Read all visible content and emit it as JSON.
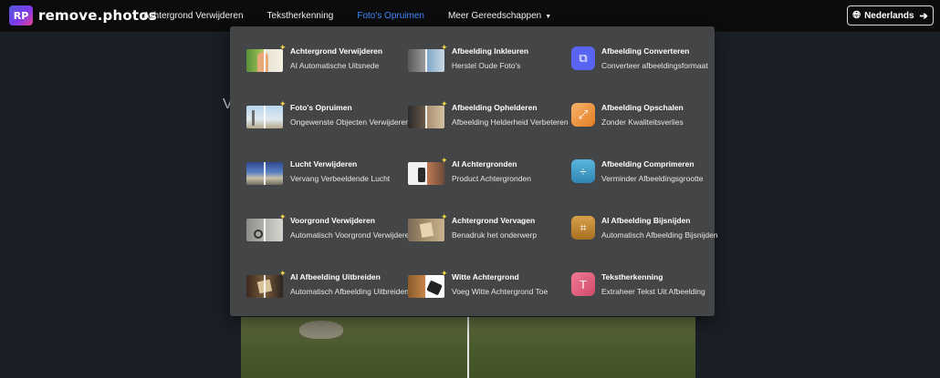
{
  "header": {
    "logo_mark": "RP",
    "logo_text": "remove.photos",
    "nav": [
      {
        "label": "Achtergrond Verwijderen"
      },
      {
        "label": "Tekstherkenning"
      },
      {
        "label": "Foto's Opruimen"
      },
      {
        "label": "Meer Gereedschappen"
      }
    ],
    "language": "Nederlands"
  },
  "background": {
    "partial_text": "V"
  },
  "menu": {
    "columns": [
      [
        {
          "title": "Achtergrond Verwijderen",
          "subtitle": "AI Automatische Uitsnede"
        },
        {
          "title": "Foto's Opruimen",
          "subtitle": "Ongewenste Objecten Verwijderen"
        },
        {
          "title": "Lucht Verwijderen",
          "subtitle": "Vervang Verbeeldende Lucht"
        },
        {
          "title": "Voorgrond Verwijderen",
          "subtitle": "Automatisch Voorgrond Verwijderen"
        },
        {
          "title": "AI Afbeelding Uitbreiden",
          "subtitle": "Automatisch Afbeelding Uitbreiden"
        }
      ],
      [
        {
          "title": "Afbeelding Inkleuren",
          "subtitle": "Herstel Oude Foto's"
        },
        {
          "title": "Afbeelding Ophelderen",
          "subtitle": "Afbeelding Helderheid Verbeteren"
        },
        {
          "title": "AI Achtergronden",
          "subtitle": "Product Achtergronden"
        },
        {
          "title": "Achtergrond Vervagen",
          "subtitle": "Benadruk het onderwerp"
        },
        {
          "title": "Witte Achtergrond",
          "subtitle": "Voeg Witte Achtergrond Toe"
        }
      ],
      [
        {
          "title": "Afbeelding Converteren",
          "subtitle": "Converteer afbeeldingsformaat"
        },
        {
          "title": "Afbeelding Opschalen",
          "subtitle": "Zonder Kwaliteitsverlies"
        },
        {
          "title": "Afbeelding Comprimeren",
          "subtitle": "Verminder Afbeeldingsgrootte"
        },
        {
          "title": "AI Afbeelding Bijsnijden",
          "subtitle": "Automatisch Afbeelding Bijsnijden"
        },
        {
          "title": "Tekstherkenning",
          "subtitle": "Extraheer Tekst Uit Afbeelding"
        }
      ]
    ]
  },
  "colors": {
    "nav_active": "#3f8cff",
    "menu_bg": "#444546",
    "sparkle": "#f5d442",
    "convert_icon": "#5865f2",
    "upscale_icon": "#f0932b",
    "compress_icon": "#3d9ec7",
    "crop_icon": "#c88a2a",
    "ocr_icon": "#e05a7a"
  },
  "icons": {
    "language": "globe-icon",
    "language_arrow": "arrow-right-icon",
    "dropdown": "caret-down-icon",
    "ai_badge": "sparkle-icon",
    "converteren": "convert-icon",
    "opschalen": "upscale-icon",
    "comprimeren": "compress-icon",
    "bijsnijden": "crop-icon",
    "tekstherkenning": "text-recognition-icon"
  }
}
